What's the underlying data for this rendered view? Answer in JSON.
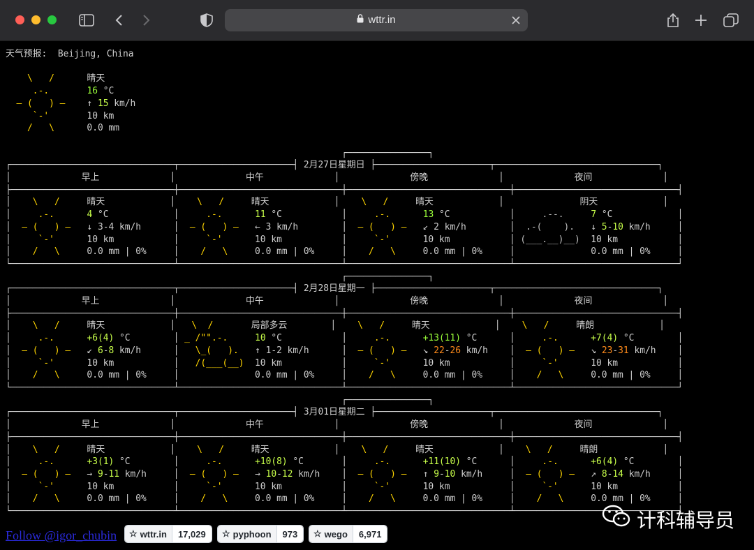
{
  "browser": {
    "url": "wttr.in",
    "colors": {
      "close": "#ff5f57",
      "minimize": "#febc2e",
      "zoom": "#28c840"
    }
  },
  "report_header": "天气预报:  Beijing, China",
  "current": {
    "condition": "晴天",
    "temperature": "16",
    "temp_unit": "°C",
    "wind_dir": "↑",
    "wind": "15",
    "wind_unit": "km/h",
    "visibility": "10 km",
    "precip": "0.0 mm"
  },
  "period_labels": [
    "早上",
    "中午",
    "傍晚",
    "夜间"
  ],
  "days": [
    {
      "date": "2月27日星期日",
      "periods": [
        {
          "art": "sun",
          "condition": "晴天",
          "temp": "4",
          "wind_dir": "↓",
          "wind": "3-4",
          "visibility": "10 km",
          "precip": "0.0 mm | 0%"
        },
        {
          "art": "sun",
          "condition": "晴天",
          "temp": "11",
          "wind_dir": "←",
          "wind": "3",
          "visibility": "10 km",
          "precip": "0.0 mm | 0%"
        },
        {
          "art": "sun",
          "condition": "晴天",
          "temp": "13",
          "wind_dir": "↙",
          "wind": "2",
          "visibility": "10 km",
          "precip": "0.0 mm | 0%"
        },
        {
          "art": "cloud",
          "condition": "阴天",
          "temp": "7",
          "wind_dir": "↓",
          "wind": "5-10",
          "visibility": "10 km",
          "precip": "0.0 mm | 0%"
        }
      ]
    },
    {
      "date": "2月28日星期一",
      "periods": [
        {
          "art": "sun",
          "condition": "晴天",
          "temp": "+6(4)",
          "wind_dir": "↙",
          "wind": "6-8",
          "visibility": "10 km",
          "precip": "0.0 mm | 0%"
        },
        {
          "art": "partly",
          "condition": "局部多云",
          "temp": "10",
          "wind_dir": "↑",
          "wind": "1-2",
          "visibility": "10 km",
          "precip": "0.0 mm | 0%"
        },
        {
          "art": "sun",
          "condition": "晴天",
          "temp": "+13(11)",
          "wind_dir": "↘",
          "wind": "22-26",
          "visibility": "10 km",
          "precip": "0.0 mm | 0%"
        },
        {
          "art": "sun",
          "condition": "晴朗",
          "temp": "+7(4)",
          "wind_dir": "↘",
          "wind": "23-31",
          "visibility": "10 km",
          "precip": "0.0 mm | 0%"
        }
      ]
    },
    {
      "date": "3月01日星期二",
      "periods": [
        {
          "art": "sun",
          "condition": "晴天",
          "temp": "+3(1)",
          "wind_dir": "→",
          "wind": "9-11",
          "visibility": "10 km",
          "precip": "0.0 mm | 0%"
        },
        {
          "art": "sun",
          "condition": "晴天",
          "temp": "+10(8)",
          "wind_dir": "→",
          "wind": "10-12",
          "visibility": "10 km",
          "precip": "0.0 mm | 0%"
        },
        {
          "art": "sun",
          "condition": "晴天",
          "temp": "+11(10)",
          "wind_dir": "↑",
          "wind": "9-10",
          "visibility": "10 km",
          "precip": "0.0 mm | 0%"
        },
        {
          "art": "sun",
          "condition": "晴朗",
          "temp": "+6(4)",
          "wind_dir": "↗",
          "wind": "8-14",
          "visibility": "10 km",
          "precip": "0.0 mm | 0%"
        }
      ]
    }
  ],
  "footer": {
    "follow_text": "Follow @igor_chubin",
    "badges": [
      {
        "label": "wttr.in",
        "count": "17,029"
      },
      {
        "label": "pyphoon",
        "count": "973"
      },
      {
        "label": "wego",
        "count": "6,971"
      }
    ]
  },
  "watermark": "计科辅导员",
  "colors": {
    "sun": "#ffd500",
    "accent_green": "#9bff3a",
    "accent_orange": "#ff8b1a",
    "text": "#cfcfcf",
    "link": "#2a2adb"
  }
}
